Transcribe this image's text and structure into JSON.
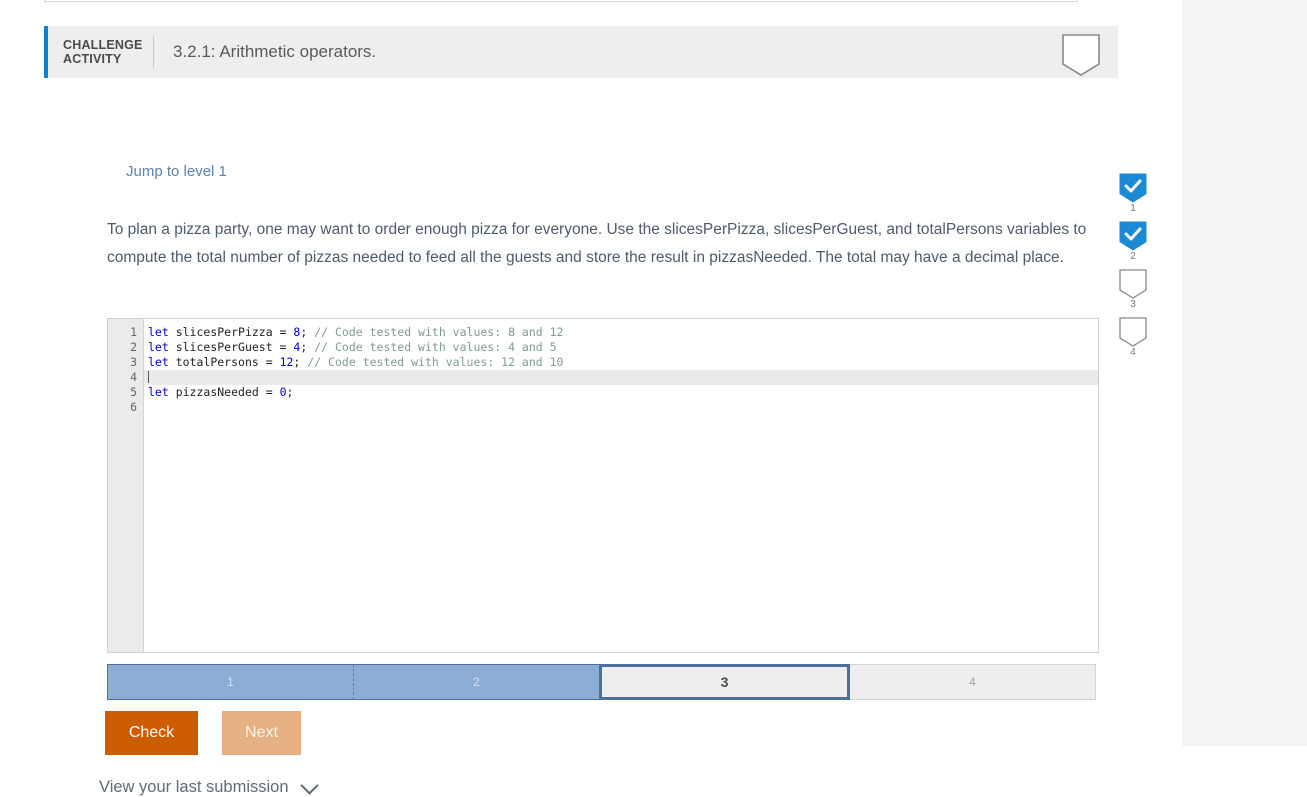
{
  "header": {
    "challenge_tag_line1": "CHALLENGE",
    "challenge_tag_line2": "ACTIVITY",
    "activity_title": "3.2.1: Arithmetic operators.",
    "accent_color": "#0b82c9",
    "band_color": "#eeeeee"
  },
  "body": {
    "jump_link": "Jump to level 1",
    "prompt": "To plan a pizza party, one may want to order enough pizza for everyone. Use the slicesPerPizza, slicesPerGuest, and totalPersons variables to compute the total number of pizzas needed to feed all the guests and store the result in pizzasNeeded. The total may have a decimal place."
  },
  "editor": {
    "line_numbers": [
      "1",
      "2",
      "3",
      "4",
      "5",
      "6"
    ],
    "active_line": 4,
    "lines": [
      {
        "n": 1,
        "segments": [
          {
            "t": "let ",
            "c": "kw"
          },
          {
            "t": "slicesPerPizza = ",
            "c": "plain"
          },
          {
            "t": "8",
            "c": "num"
          },
          {
            "t": "; ",
            "c": "plain"
          },
          {
            "t": "// Code tested with values: 8 and 12",
            "c": "cmt"
          }
        ]
      },
      {
        "n": 2,
        "segments": [
          {
            "t": "let ",
            "c": "kw"
          },
          {
            "t": "slicesPerGuest = ",
            "c": "plain"
          },
          {
            "t": "4",
            "c": "num"
          },
          {
            "t": "; ",
            "c": "plain"
          },
          {
            "t": "// Code tested with values: 4 and 5",
            "c": "cmt"
          }
        ]
      },
      {
        "n": 3,
        "segments": [
          {
            "t": "let ",
            "c": "kw"
          },
          {
            "t": "totalPersons = ",
            "c": "plain"
          },
          {
            "t": "12",
            "c": "num"
          },
          {
            "t": "; ",
            "c": "plain"
          },
          {
            "t": "// Code tested with values: 12 and 10",
            "c": "cmt"
          }
        ]
      },
      {
        "n": 4,
        "segments": []
      },
      {
        "n": 5,
        "segments": [
          {
            "t": "let ",
            "c": "kw"
          },
          {
            "t": "pizzasNeeded = ",
            "c": "plain"
          },
          {
            "t": "0",
            "c": "num"
          },
          {
            "t": ";",
            "c": "plain"
          }
        ]
      },
      {
        "n": 6,
        "segments": []
      }
    ]
  },
  "progress": {
    "segments": [
      {
        "label": "1",
        "state": "done"
      },
      {
        "label": "2",
        "state": "done"
      },
      {
        "label": "3",
        "state": "active"
      },
      {
        "label": "4",
        "state": "todo"
      }
    ],
    "done_color": "#8cadd4",
    "active_border_color": "#4f6f9b",
    "todo_color": "#eeeeee"
  },
  "buttons": {
    "check": "Check",
    "next": "Next",
    "check_color": "#cc5c00",
    "next_color": "#e5b184"
  },
  "footer": {
    "last_submission": "View your last submission",
    "chevron_icon": "chevron-down-icon"
  },
  "levels": {
    "header_badge": {
      "state": "empty",
      "icon": "shield-badge-outline-icon"
    },
    "items": [
      {
        "number": "1",
        "state": "complete",
        "icon": "shield-badge-check-icon"
      },
      {
        "number": "2",
        "state": "complete",
        "icon": "shield-badge-check-icon"
      },
      {
        "number": "3",
        "state": "empty",
        "icon": "shield-badge-outline-icon"
      },
      {
        "number": "4",
        "state": "empty",
        "icon": "shield-badge-outline-icon"
      }
    ],
    "complete_color": "#1b8ad4",
    "outline_color": "#888888"
  }
}
